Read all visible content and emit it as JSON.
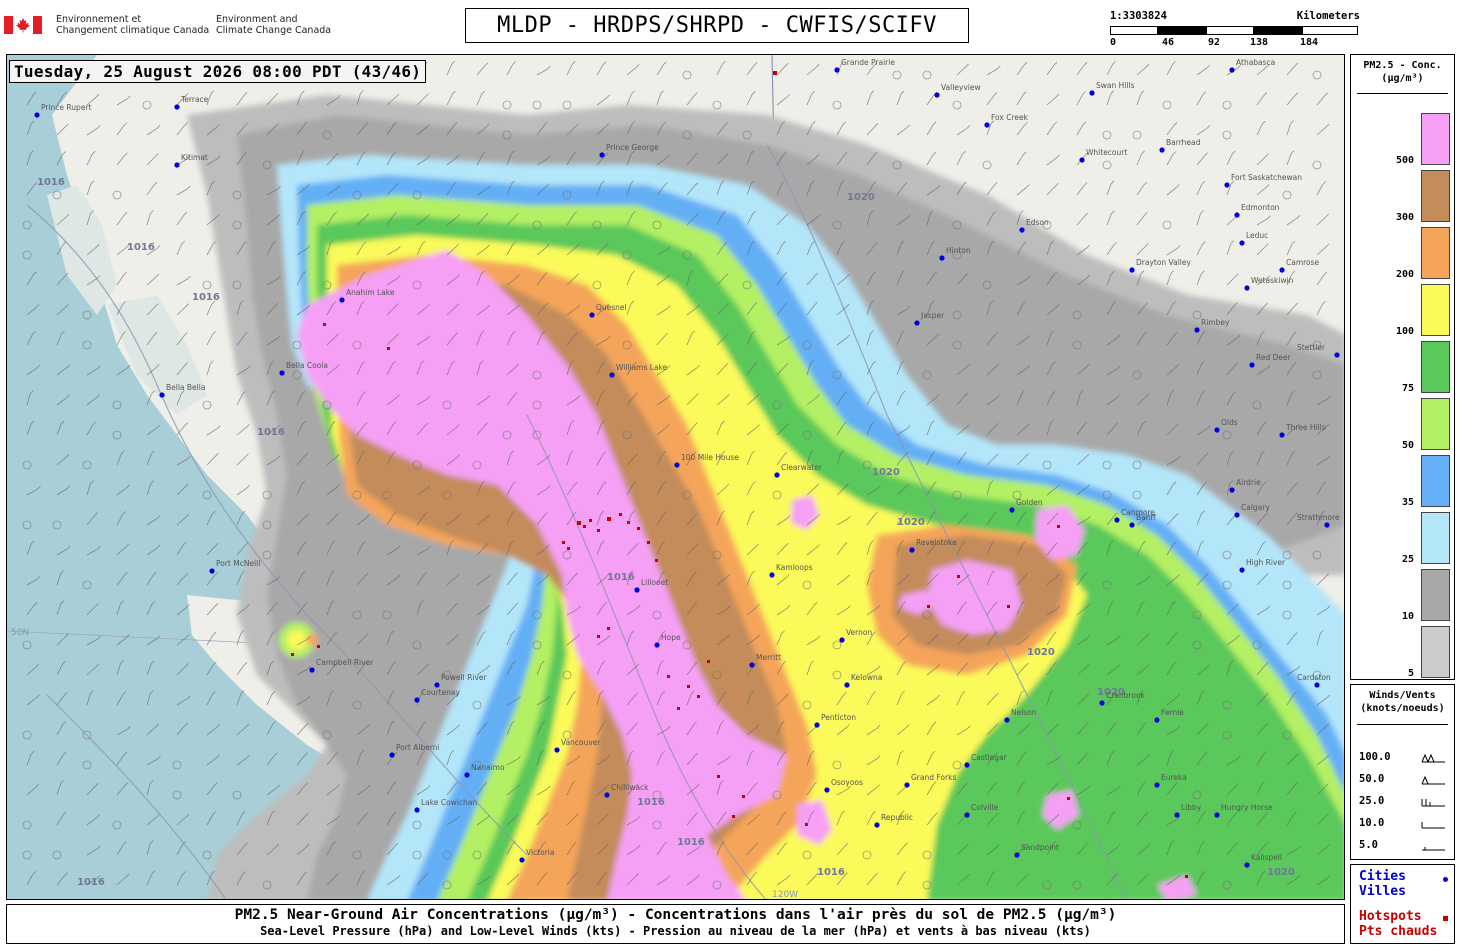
{
  "header": {
    "gc_fr_line1": "Environnement et",
    "gc_fr_line2": "Changement climatique Canada",
    "gc_en_line1": "Environment and",
    "gc_en_line2": "Climate Change Canada",
    "title": "MLDP - HRDPS/SHRPD - CWFIS/SCIFV"
  },
  "scale": {
    "ratio": "1:3303824",
    "unit": "Kilometers",
    "ticks": [
      "0",
      "46",
      "92",
      "138",
      "184"
    ]
  },
  "map": {
    "timestamp": "Tuesday, 25 August 2026 08:00 PDT (43/46)",
    "colors": {
      "ocean": "#a8cfd8",
      "land": "#efeee8",
      "c5": "#cccccc",
      "c10": "#a8a8a8",
      "c25": "#b4e6fa",
      "c35": "#64aff5",
      "c50": "#b4f064",
      "c75": "#5ac85a",
      "c100": "#fafa5a",
      "c200": "#f5a55a",
      "c300": "#c38c5a",
      "c500": "#f5a0f5",
      "hotspot": "#c80000",
      "city": "#0000dd"
    },
    "isobar_labels": [
      "1016",
      "1016",
      "1016",
      "1016",
      "1016",
      "1020",
      "1020",
      "1016",
      "1020",
      "1016",
      "1020",
      "1016",
      "1020",
      "1016",
      "1020"
    ],
    "cities": [
      "Terrace",
      "Kitimat",
      "Prince Rupert",
      "Prince George",
      "Quesnel",
      "Williams Lake",
      "Bella Coola",
      "Bella Bella",
      "Port McNeill",
      "Campbell River",
      "Courtenay",
      "Nanaimo",
      "Victoria",
      "Vancouver",
      "Chilliwack",
      "Hope",
      "Merritt",
      "Kamloops",
      "Vernon",
      "Kelowna",
      "Penticton",
      "Osoyoos",
      "Grand Forks",
      "Castlegar",
      "Nelson",
      "Cranbrook",
      "Fernie",
      "Revelstoke",
      "Golden",
      "Clearwater",
      "100 Mile House",
      "Lillooet",
      "Jasper",
      "Hinton",
      "Edson",
      "Whitecourt",
      "Fox Creek",
      "Swan Hills",
      "Barrhead",
      "Edmonton",
      "Fort Saskatchewan",
      "Leduc",
      "Drayton Valley",
      "Camrose",
      "Wetaskiwin",
      "Rimbey",
      "Red Deer",
      "Olds",
      "Three Hills",
      "Airdrie",
      "Calgary",
      "High River",
      "Canmore",
      "Banff",
      "Grande Prairie",
      "Valleyview",
      "Athabasca",
      "Anahim Lake",
      "Powell River",
      "Port Alberni",
      "Lake Cowichan",
      "Stettler",
      "Strathmore",
      "Sandpoint",
      "Libby",
      "Eureka",
      "Kalispell",
      "Republic",
      "Colville",
      "Hungry Horse",
      "Cardston"
    ],
    "gridline_labels": [
      "50N",
      "120W"
    ]
  },
  "pm_legend": {
    "title_line1": "PM2.5 - Conc.",
    "title_line2": "(μg/m³)",
    "levels": [
      {
        "label": "500",
        "color": "#f5a0f5"
      },
      {
        "label": "300",
        "color": "#c38c5a"
      },
      {
        "label": "200",
        "color": "#f5a55a"
      },
      {
        "label": "100",
        "color": "#fafa5a"
      },
      {
        "label": "75",
        "color": "#5ac85a"
      },
      {
        "label": "50",
        "color": "#b4f064"
      },
      {
        "label": "35",
        "color": "#64aff5"
      },
      {
        "label": "25",
        "color": "#b4e6fa"
      },
      {
        "label": "10",
        "color": "#a8a8a8"
      },
      {
        "label": "5",
        "color": "#cccccc"
      }
    ]
  },
  "wind_legend": {
    "title_line1": "Winds/Vents",
    "title_line2": "(knots/noeuds)",
    "rows": [
      "100.0",
      "50.0",
      "25.0",
      "10.0",
      "5.0"
    ]
  },
  "points_legend": {
    "cities_en": "Cities",
    "cities_fr": "Villes",
    "hotspots_en": "Hotspots",
    "hotspots_fr": "Pts chauds"
  },
  "footer": {
    "main": "PM2.5 Near-Ground Air Concentrations (μg/m³) - Concentrations dans l'air près du sol de PM2.5 (μg/m³)",
    "sub": "Sea-Level Pressure (hPa) and Low-Level Winds (kts) - Pression au niveau de la mer (hPa) et vents à bas niveau (kts)"
  }
}
